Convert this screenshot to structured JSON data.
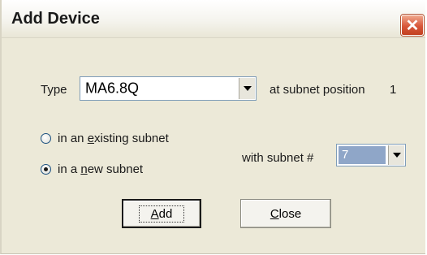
{
  "window": {
    "title": "Add Device",
    "close_glyph": "✕"
  },
  "type_row": {
    "label": "Type",
    "selected": "MA6.8Q",
    "position_label": "at subnet position",
    "position_value": "1"
  },
  "subnet_options": [
    {
      "pre": "in an ",
      "accel": "e",
      "post": "xisting subnet",
      "checked": false
    },
    {
      "pre": "in a ",
      "accel": "n",
      "post": "ew subnet",
      "checked": true
    }
  ],
  "subnet_number": {
    "label": "with subnet #",
    "selected": "7"
  },
  "buttons": {
    "add_accel": "A",
    "add_rest": "dd",
    "close_accel": "C",
    "close_rest": "lose"
  },
  "icons": {
    "close": "close-icon",
    "dropdown": "chevron-down-icon"
  },
  "colors": {
    "dialog_bg": "#ece9d8",
    "close_button": "#d8573a",
    "combo_selected_bg": "#8fa6c8"
  }
}
